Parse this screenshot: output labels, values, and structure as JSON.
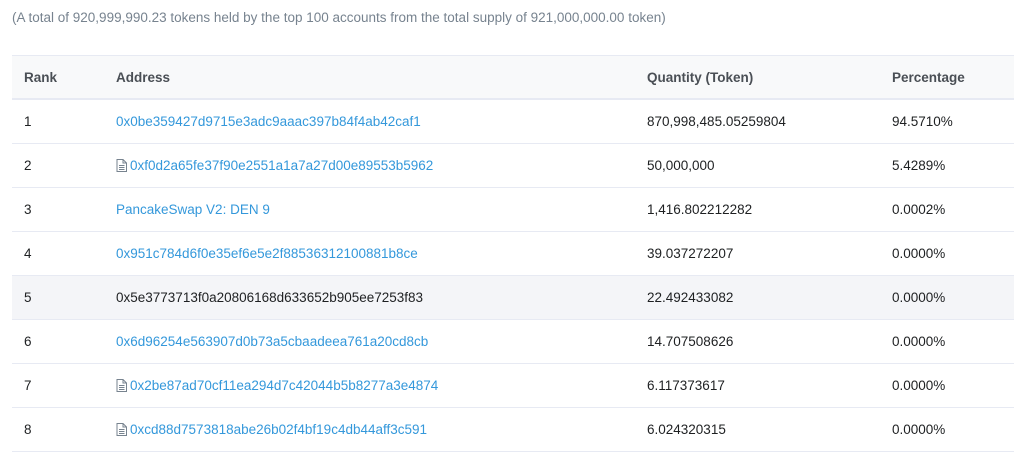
{
  "summary": "(A total of 920,999,990.23 tokens held by the top 100 accounts from the total supply of 921,000,000.00 token)",
  "columns": {
    "rank": "Rank",
    "address": "Address",
    "quantity": "Quantity (Token)",
    "percentage": "Percentage"
  },
  "rows": [
    {
      "rank": "1",
      "address": "0x0be359427d9715e3adc9aaac397b84f4ab42caf1",
      "contract": false,
      "quantity": "870,998,485.05259804",
      "percentage": "94.5710%"
    },
    {
      "rank": "2",
      "address": "0xf0d2a65fe37f90e2551a1a7a27d00e89553b5962",
      "contract": true,
      "quantity": "50,000,000",
      "percentage": "5.4289%"
    },
    {
      "rank": "3",
      "address": "PancakeSwap V2: DEN 9",
      "contract": false,
      "quantity": "1,416.802212282",
      "percentage": "0.0002%"
    },
    {
      "rank": "4",
      "address": "0x951c784d6f0e35ef6e5e2f88536312100881b8ce",
      "contract": false,
      "quantity": "39.037272207",
      "percentage": "0.0000%"
    },
    {
      "rank": "5",
      "address": "0x5e3773713f0a20806168d633652b905ee7253f83",
      "contract": false,
      "quantity": "22.492433082",
      "percentage": "0.0000%",
      "highlighted": true
    },
    {
      "rank": "6",
      "address": "0x6d96254e563907d0b73a5cbaadeea761a20cd8cb",
      "contract": false,
      "quantity": "14.707508626",
      "percentage": "0.0000%"
    },
    {
      "rank": "7",
      "address": "0x2be87ad70cf11ea294d7c42044b5b8277a3e4874",
      "contract": true,
      "quantity": "6.117373617",
      "percentage": "0.0000%"
    },
    {
      "rank": "8",
      "address": "0xcd88d7573818abe26b02f4bf19c4db44aff3c591",
      "contract": true,
      "quantity": "6.024320315",
      "percentage": "0.0000%"
    }
  ],
  "colors": {
    "link": "#3498db",
    "muted": "#77838f",
    "highlight_row": "#f4f5f8"
  },
  "icons": {
    "contract": "file-text-icon"
  }
}
